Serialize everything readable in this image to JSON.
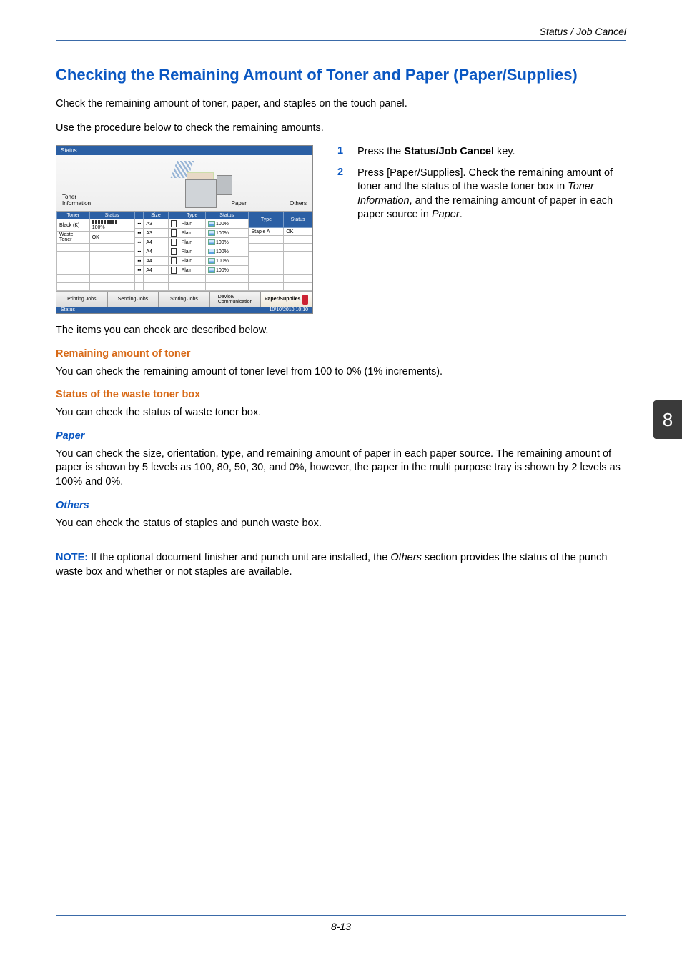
{
  "header": {
    "section": "Status / Job Cancel"
  },
  "title": "Checking the Remaining Amount of Toner and Paper (Paper/Supplies)",
  "intro1": "Check the remaining amount of toner, paper, and staples on the touch panel.",
  "intro2": "Use the procedure below to check the remaining amounts.",
  "steps": {
    "s1": {
      "num": "1",
      "pre": "Press the ",
      "bold": "Status/Job Cancel",
      "post": " key."
    },
    "s2": {
      "num": "2",
      "pre": "Press [Paper/Supplies]. Check the remaining amount of toner and the status of the waste toner box in ",
      "ital1": "Toner Information",
      "mid": ", and the remaining amount of paper in each paper source in ",
      "ital2": "Paper",
      "post": "."
    }
  },
  "panel": {
    "barTop": "Status",
    "tonerInfo": "Toner Information",
    "paperLbl": "Paper",
    "othersLbl": "Others",
    "tonerHdr": {
      "c1": "Toner",
      "c2": "Status"
    },
    "tonerRows": [
      {
        "name": "Black (K)",
        "pct": "100%"
      },
      {
        "name": "Waste Toner",
        "pct": "OK"
      }
    ],
    "paperHdr": {
      "c1": "Size",
      "c2": "Type",
      "c3": "Status"
    },
    "paperRows": [
      {
        "size": "A3",
        "type": "Plain",
        "status": "100%"
      },
      {
        "size": "A3",
        "type": "Plain",
        "status": "100%"
      },
      {
        "size": "A4",
        "type": "Plain",
        "status": "100%"
      },
      {
        "size": "A4",
        "type": "Plain",
        "status": "100%"
      },
      {
        "size": "A4",
        "type": "Plain",
        "status": "100%"
      },
      {
        "size": "A4",
        "type": "Plain",
        "status": "100%"
      }
    ],
    "othersHdr": {
      "c1": "Type",
      "c2": "Status"
    },
    "othersRows": [
      {
        "type": "Staple A",
        "status": "OK"
      }
    ],
    "tabs": {
      "printing": "Printing Jobs",
      "sending": "Sending Jobs",
      "storing": "Storing Jobs",
      "device": "Device/\nCommunication",
      "supplies": "Paper/Supplies"
    },
    "footLeft": "Status",
    "footRight": "10/10/2010  10:10"
  },
  "afterPanel": "The items you can check are described below.",
  "sec1": {
    "h": "Remaining amount of toner",
    "p": "You can check the remaining amount of toner level from 100 to 0% (1% increments)."
  },
  "sec2": {
    "h": "Status of the waste toner box",
    "p": "You can check the status of waste toner box."
  },
  "sec3": {
    "h": "Paper",
    "p": "You can check the size, orientation, type, and remaining amount of paper in each paper source. The remaining amount of paper is shown by 5 levels as 100, 80, 50, 30, and 0%, however, the paper in the multi purpose tray is shown by 2 levels as 100% and 0%."
  },
  "sec4": {
    "h": "Others",
    "p": "You can check the status of staples and punch waste box."
  },
  "note": {
    "label": "NOTE:",
    "pre": " If the optional document finisher and punch unit are installed, the ",
    "ital": "Others",
    "post": " section provides the status of the punch waste box and whether or not staples are available."
  },
  "sideTab": "8",
  "pageNum": "8-13"
}
